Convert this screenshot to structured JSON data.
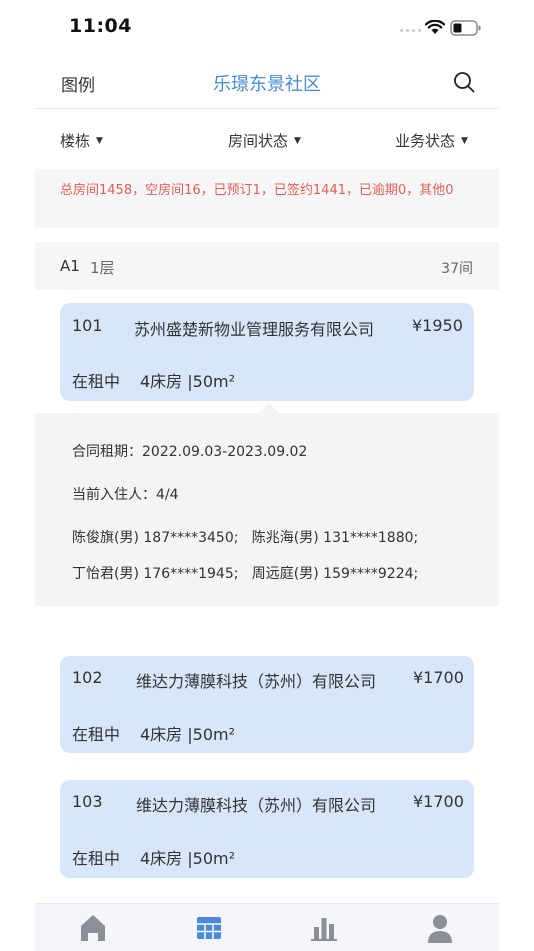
{
  "status_bar": {
    "time": "11:04"
  },
  "nav": {
    "legend_label": "图例",
    "title": "乐璟东景社区"
  },
  "filters": [
    {
      "label": "楼栋"
    },
    {
      "label": "房间状态"
    },
    {
      "label": "业务状态"
    }
  ],
  "summary": "总房间1458，空房间16，已预订1，已签约1441，已逾期0，其他0",
  "floor": {
    "code": "A1",
    "level": "1层",
    "count": "37间"
  },
  "rooms": [
    {
      "number": "101",
      "company": "苏州盛楚新物业管理服务有限公司",
      "price": "¥1950",
      "status": "在租中",
      "type": "4床房 |50m²"
    },
    {
      "number": "102",
      "company": "维达力薄膜科技（苏州）有限公司",
      "price": "¥1700",
      "status": "在租中",
      "type": "4床房 |50m²"
    },
    {
      "number": "103",
      "company": "维达力薄膜科技（苏州）有限公司",
      "price": "¥1700",
      "status": "在租中",
      "type": "4床房 |50m²"
    }
  ],
  "detail": {
    "contract": "合同租期：2022.09.03-2023.09.02",
    "occupancy": "当前入住人：4/4",
    "residents_line1": "陈俊旗(男) 187****3450;   陈兆海(男) 131****1880;",
    "residents_line2": "丁怡君(男) 176****1945;   周远庭(男) 159****9224;"
  },
  "tabbar": {
    "icons": [
      "home-icon",
      "grid-icon",
      "bar-chart-icon",
      "person-icon"
    ],
    "active_color": "#4a8ad6",
    "inactive_color": "#8a8f99"
  },
  "colors": {
    "accent": "#4a8ad6",
    "warning": "#e06055",
    "card_bg": "#d8e6fb"
  }
}
